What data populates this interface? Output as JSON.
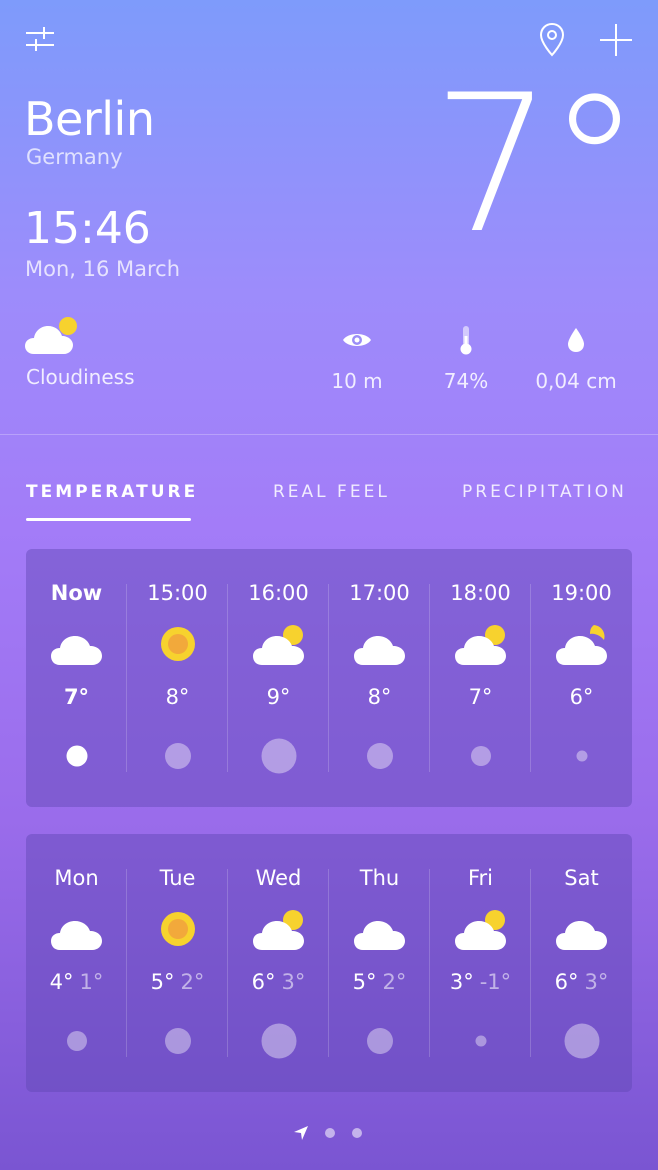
{
  "location": {
    "city": "Berlin",
    "country": "Germany"
  },
  "time": "15:46",
  "date": "Mon, 16 March",
  "current_temp": "7°",
  "condition": {
    "label": "Cloudiness",
    "icon": "cloud-sun-icon"
  },
  "stats": [
    {
      "name": "visibility",
      "icon": "eye-icon",
      "value": "10 m"
    },
    {
      "name": "humidity",
      "icon": "thermometer-icon",
      "value": "74%"
    },
    {
      "name": "precipitation",
      "icon": "drop-icon",
      "value": "0,04 cm"
    }
  ],
  "tabs": [
    {
      "label": "TEMPERATURE",
      "active": true
    },
    {
      "label": "REAL FEEL",
      "active": false
    },
    {
      "label": "PRECIPITATION",
      "active": false
    }
  ],
  "hourly": [
    {
      "label": "Now",
      "icon": "cloud-icon",
      "temp": "7°",
      "precip_level": 0.45
    },
    {
      "label": "15:00",
      "icon": "sun-icon",
      "temp": "8°",
      "precip_level": 0.6
    },
    {
      "label": "16:00",
      "icon": "cloud-sun-icon",
      "temp": "9°",
      "precip_level": 0.85
    },
    {
      "label": "17:00",
      "icon": "cloud-icon",
      "temp": "8°",
      "precip_level": 0.6
    },
    {
      "label": "18:00",
      "icon": "cloud-sun-icon",
      "temp": "7°",
      "precip_level": 0.4
    },
    {
      "label": "19:00",
      "icon": "cloud-moon-icon",
      "temp": "6°",
      "precip_level": 0.15
    }
  ],
  "daily": [
    {
      "label": "Mon",
      "icon": "cloud-icon",
      "high": "4°",
      "low": "1°",
      "precip_level": 0.4
    },
    {
      "label": "Tue",
      "icon": "sun-icon",
      "high": "5°",
      "low": "2°",
      "precip_level": 0.6
    },
    {
      "label": "Wed",
      "icon": "cloud-sun-icon",
      "high": "6°",
      "low": "3°",
      "precip_level": 0.85
    },
    {
      "label": "Thu",
      "icon": "cloud-icon",
      "high": "5°",
      "low": "2°",
      "precip_level": 0.6
    },
    {
      "label": "Fri",
      "icon": "cloud-sun-icon",
      "high": "3°",
      "low": "-1°",
      "precip_level": 0.15
    },
    {
      "label": "Sat",
      "icon": "cloud-icon",
      "high": "6°",
      "low": "3°",
      "precip_level": 0.85
    }
  ],
  "pager": {
    "pages": 3,
    "current": 0
  },
  "colors": {
    "sun": "#f7d22e",
    "sun_core": "#f2a93b",
    "cloud": "#ffffff"
  }
}
